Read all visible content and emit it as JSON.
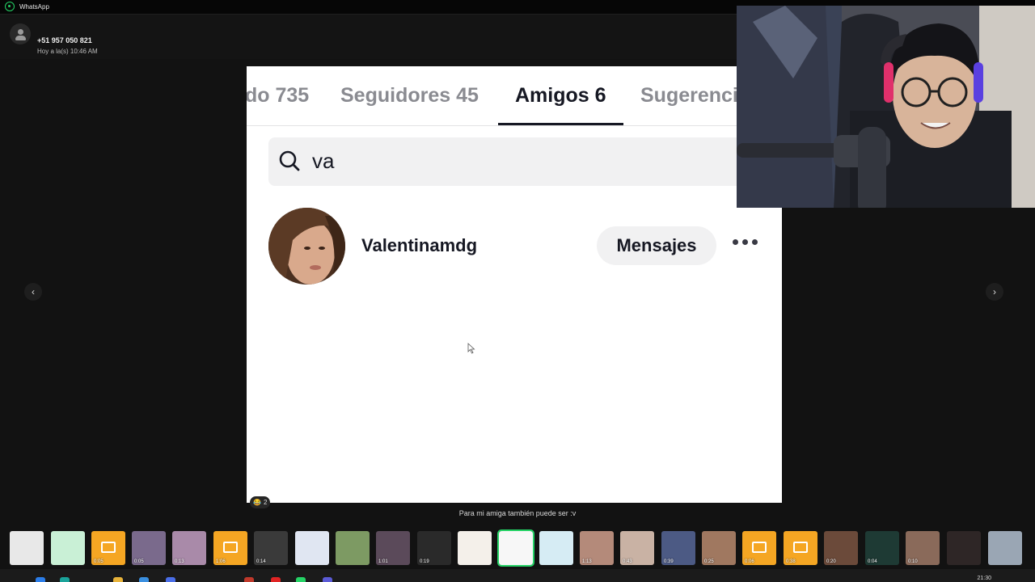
{
  "titlebar": {
    "app_name": "WhatsApp"
  },
  "chat": {
    "contact": "+51 957 050 821",
    "timestamp": "Hoy a la(s) 10:46 AM"
  },
  "tiktok": {
    "tabs": [
      {
        "label": "do 735"
      },
      {
        "label": "Seguidores 45"
      },
      {
        "label": "Amigos 6"
      },
      {
        "label": "Sugerenci"
      }
    ],
    "search": {
      "value": "va"
    },
    "result": {
      "username": "Valentinamdg",
      "message_label": "Mensajes"
    }
  },
  "reaction": {
    "emoji": "😂",
    "count": "2"
  },
  "caption": "Para mi amiga también puede ser :v",
  "thumbnails": [
    {
      "tag": ""
    },
    {
      "tag": ""
    },
    {
      "tag": "0:05"
    },
    {
      "tag": "0:05"
    },
    {
      "tag": "0:13"
    },
    {
      "tag": "1:06"
    },
    {
      "tag": "0:14"
    },
    {
      "tag": ""
    },
    {
      "tag": ""
    },
    {
      "tag": "1:01"
    },
    {
      "tag": "0:19"
    },
    {
      "tag": ""
    },
    {
      "tag": ""
    },
    {
      "tag": ""
    },
    {
      "tag": "1:13"
    },
    {
      "tag": "0:43"
    },
    {
      "tag": "0:39"
    },
    {
      "tag": "0:25"
    },
    {
      "tag": "0:06"
    },
    {
      "tag": "0:38"
    },
    {
      "tag": "0:20"
    },
    {
      "tag": "0:04"
    },
    {
      "tag": "0:10"
    },
    {
      "tag": ""
    },
    {
      "tag": ""
    }
  ],
  "taskbar": {
    "clock": "21:30"
  },
  "colors": {
    "accent": "#25d366",
    "thumb_orange": "#f5a623",
    "text_dark": "#161823"
  }
}
